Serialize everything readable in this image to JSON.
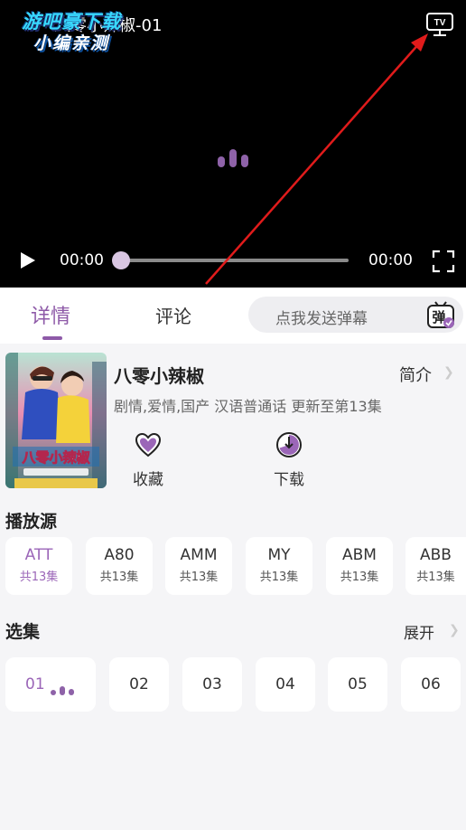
{
  "player": {
    "title": "八零小辣椒-01",
    "watermark_line1": "游吧豪下载",
    "watermark_line2": "小编亲测",
    "tv_label": "TV",
    "current_time": "00:00",
    "total_time": "00:00",
    "progress": 0
  },
  "tabs": {
    "details": "详情",
    "comments": "评论"
  },
  "danmaku": {
    "placeholder": "点我发送弹幕",
    "icon_text": "弹"
  },
  "show": {
    "title": "八零小辣椒",
    "intro": "简介",
    "meta": "剧情,爱情,国产 汉语普通话 更新至第13集",
    "poster_text": "八零小辣椒"
  },
  "actions": {
    "favorite": "收藏",
    "download": "下载"
  },
  "sources": {
    "title": "播放源",
    "items": [
      {
        "name": "ATT",
        "count": "共13集"
      },
      {
        "name": "A80",
        "count": "共13集"
      },
      {
        "name": "AMM",
        "count": "共13集"
      },
      {
        "name": "MY",
        "count": "共13集"
      },
      {
        "name": "ABM",
        "count": "共13集"
      },
      {
        "name": "ABB",
        "count": "共13集"
      }
    ]
  },
  "episodes": {
    "title": "选集",
    "expand": "展开",
    "items": [
      "01",
      "02",
      "03",
      "04",
      "05",
      "06"
    ]
  },
  "colors": {
    "accent": "#8e5aa8",
    "player_bg": "#000000",
    "page_bg": "#f5f5f7",
    "annotation_arrow": "#e01b1b"
  }
}
